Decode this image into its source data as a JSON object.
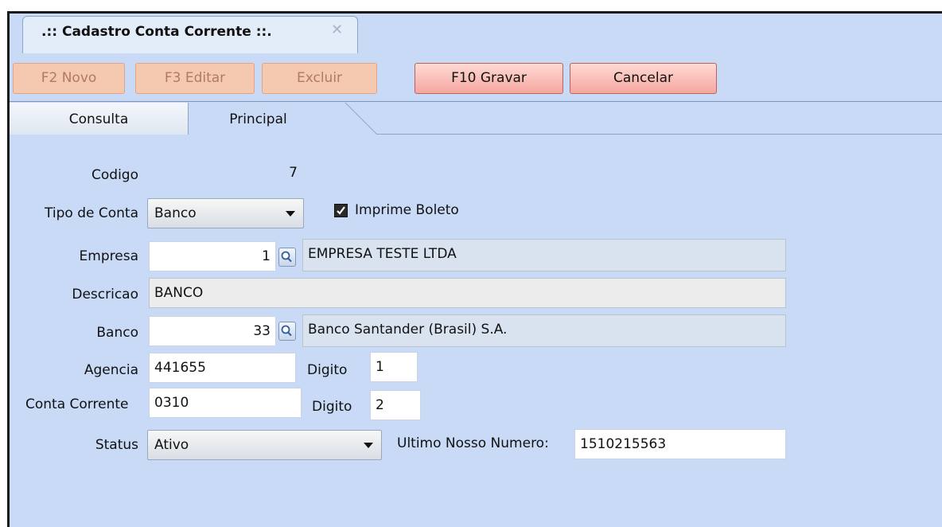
{
  "window": {
    "tab_title": ".:: Cadastro Conta Corrente ::.",
    "close_glyph": "✕"
  },
  "toolbar": {
    "novo": "F2 Novo",
    "editar": "F3 Editar",
    "excluir": "Excluir",
    "gravar": "F10 Gravar",
    "cancelar": "Cancelar"
  },
  "tabs": [
    {
      "label": "Consulta",
      "active": false
    },
    {
      "label": "Principal",
      "active": true
    }
  ],
  "form": {
    "codigo": {
      "label": "Codigo",
      "value": "7"
    },
    "tipo_conta": {
      "label": "Tipo de Conta",
      "value": "Banco"
    },
    "imprime_boleto": {
      "label": "Imprime Boleto",
      "checked": true
    },
    "empresa": {
      "label": "Empresa",
      "code": "1",
      "name": "EMPRESA TESTE LTDA"
    },
    "descricao": {
      "label": "Descricao",
      "value": "BANCO"
    },
    "banco": {
      "label": "Banco",
      "code": "33",
      "name": "Banco Santander (Brasil) S.A."
    },
    "agencia": {
      "label": "Agencia",
      "value": "441655",
      "digito_label": "Digito",
      "digito": "1"
    },
    "conta_corrente": {
      "label": "Conta Corrente",
      "value": "0310",
      "digito_label": "Digito",
      "digito": "2"
    },
    "status": {
      "label": "Status",
      "value": "Ativo"
    },
    "ultimo_nosso_numero": {
      "label": "Ultimo Nosso Numero:",
      "value": "1510215563"
    }
  },
  "colors": {
    "background": "#c9daf6",
    "disabled_button": "#f5c9b0",
    "active_button": "#f5a7a0",
    "checkbox": "#2a2a2a"
  }
}
